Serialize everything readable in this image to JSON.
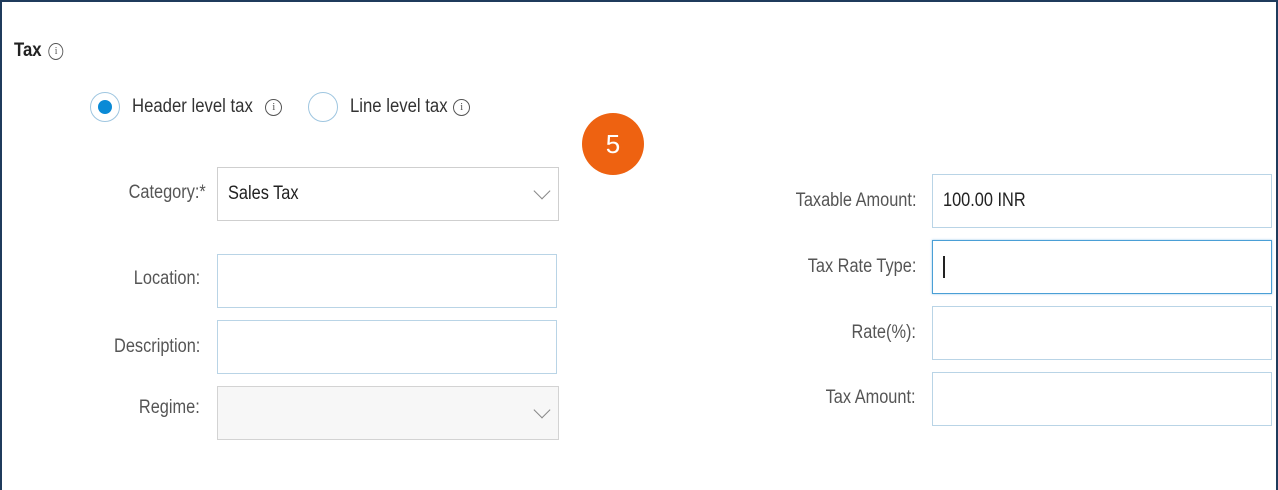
{
  "section": {
    "title": "Tax",
    "info_icon": "info-icon"
  },
  "tax_level": {
    "options": [
      {
        "label": "Header level tax",
        "checked": true
      },
      {
        "label": "Line level tax",
        "checked": false
      }
    ]
  },
  "step_badge": {
    "number": "5",
    "color": "#ee6211"
  },
  "fields": {
    "category": {
      "label": "Category:",
      "required_marker": "*",
      "value": "Sales Tax"
    },
    "location": {
      "label": "Location:",
      "value": ""
    },
    "description": {
      "label": "Description:",
      "value": ""
    },
    "regime": {
      "label": "Regime:",
      "value": ""
    },
    "taxable_amount": {
      "label": "Taxable Amount:",
      "value": "100.00 INR"
    },
    "tax_rate_type": {
      "label": "Tax Rate Type:",
      "value": ""
    },
    "rate": {
      "label": "Rate(%):",
      "value": ""
    },
    "tax_amount": {
      "label": "Tax Amount:",
      "value": ""
    }
  },
  "colors": {
    "accent": "#0a8ad6",
    "frame": "#1f3b5c",
    "input_border": "#b9d4e6"
  }
}
